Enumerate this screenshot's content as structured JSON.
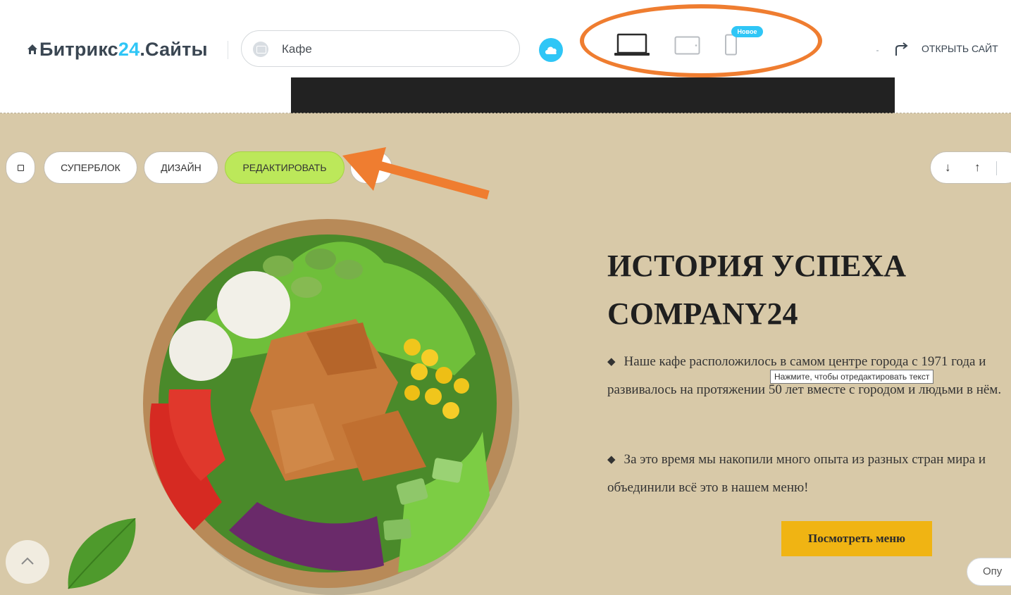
{
  "topbar": {
    "brand_prefix": "Битрикс",
    "brand_num": "24",
    "brand_suffix": ".Сайты",
    "site_name": "Кафе",
    "new_badge": "Новое",
    "open_site_label": "ОТКРЫТЬ САЙТ",
    "icons": [
      "home-icon",
      "site-thumb-icon",
      "cloud-icon",
      "laptop-icon",
      "tablet-icon",
      "phone-icon",
      "redo-icon"
    ]
  },
  "block_toolbar": {
    "superblock": "СУПЕРБЛОК",
    "design": "ДИЗАЙН",
    "edit": "РЕДАКТИРОВАТЬ",
    "move_down": "↓",
    "move_up": "↑"
  },
  "block": {
    "heading_line1": "ИСТОРИЯ УСПЕХА",
    "heading_line2": "COMPANY24",
    "bullet": "◆",
    "para1": "Наше кафе расположилось в самом центре города с 1971 года и развивалось на протяжении 50 лет вместе с городом и людьми в нём.",
    "para2": "За это время мы накопили много опыта из разных стран мира и объединили всё это в нашем меню!",
    "button": "Посмотреть меню",
    "tooltip": "Нажмите, чтобы отредактировать текст",
    "publish_partial": "Опу"
  },
  "colors": {
    "accent_blue": "#2fc6f6",
    "highlight_orange": "#ef7d30",
    "edit_green": "#bce85a",
    "hero_bg": "#d8c9a8",
    "menu_button": "#f0b413"
  }
}
